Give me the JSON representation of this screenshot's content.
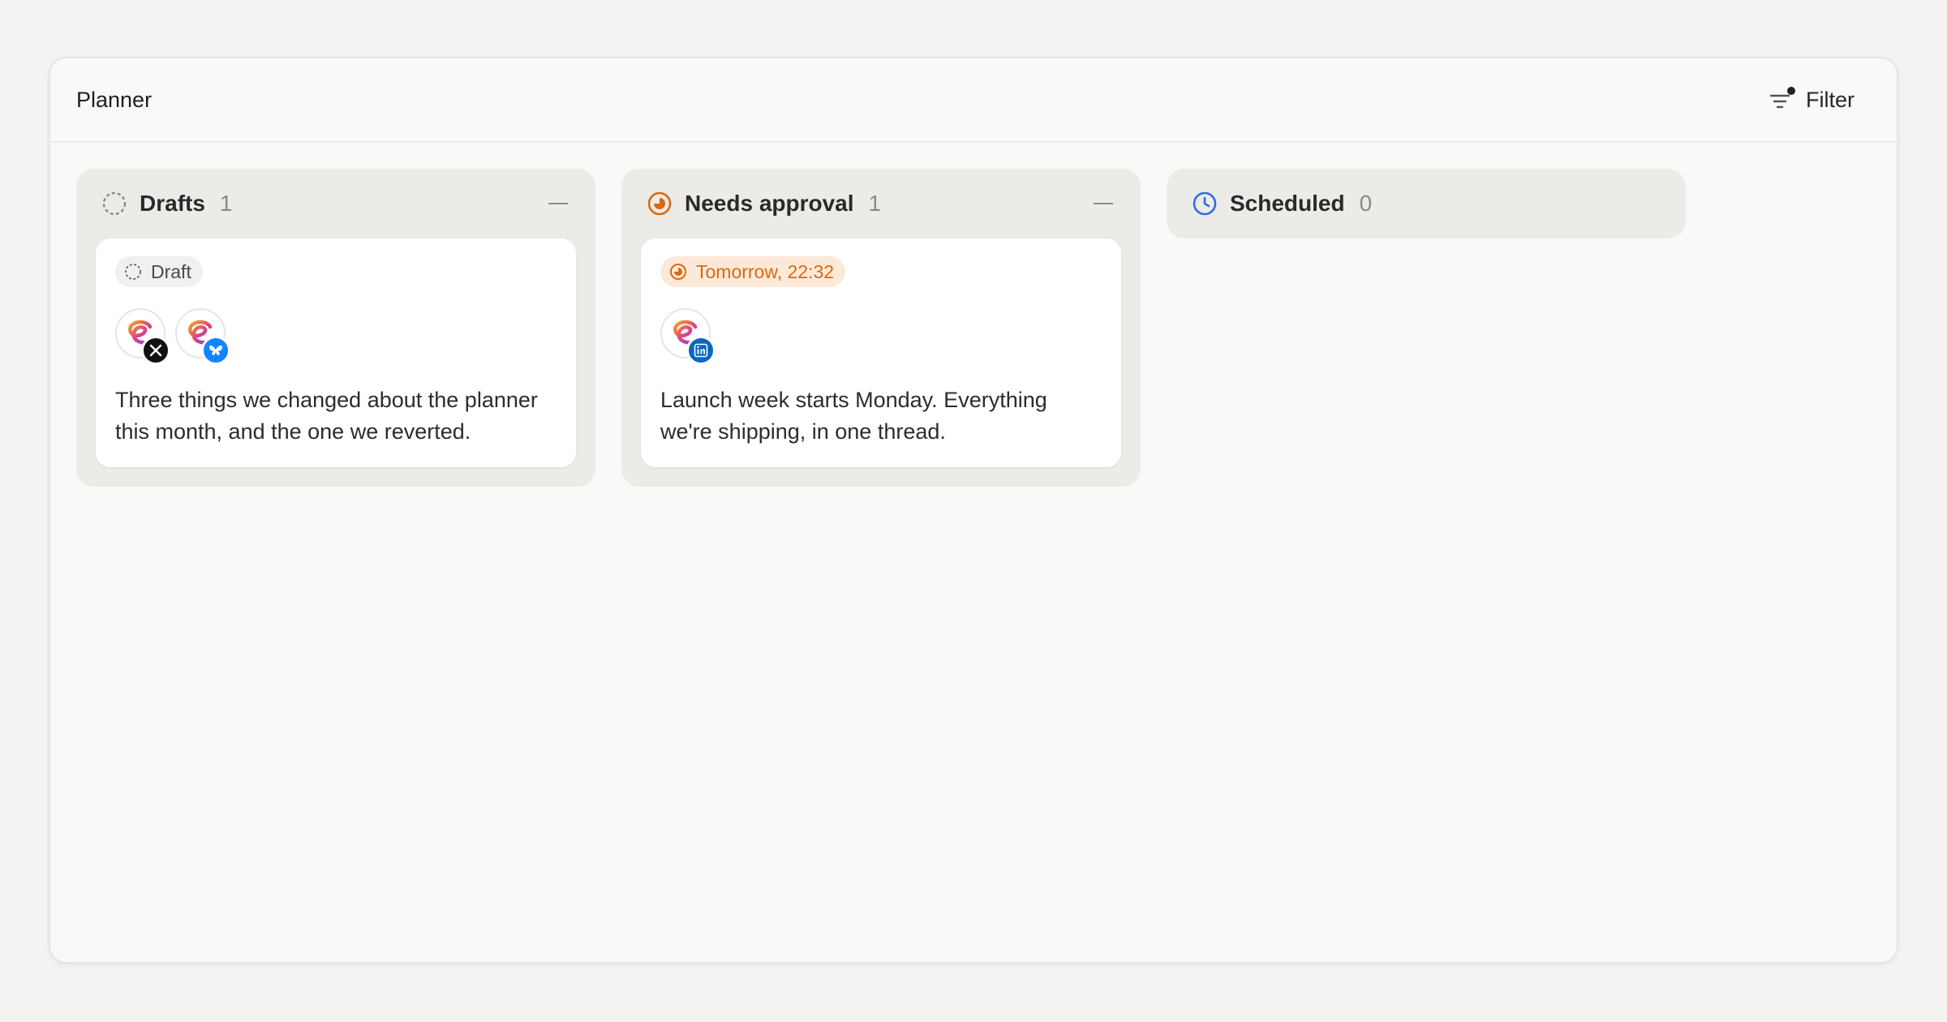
{
  "header": {
    "title": "Planner",
    "filter_label": "Filter"
  },
  "columns": [
    {
      "title": "Drafts",
      "count": "1",
      "card": {
        "pill": "Draft",
        "text": "Three things we changed about the planner this month, and the one we reverted.",
        "networks": [
          "x-icon",
          "bluesky-icon"
        ]
      }
    },
    {
      "title": "Needs approval",
      "count": "1",
      "card": {
        "pill": "Tomorrow, 22:32",
        "text": "Launch week starts Monday. Everything we're shipping, in one thread.",
        "networks": [
          "linkedin-icon"
        ]
      }
    },
    {
      "title": "Scheduled",
      "count": "0"
    }
  ],
  "colors": {
    "approval": "#d96a10",
    "scheduled": "#2f6fe0",
    "x": "#111111",
    "bluesky": "#1185fe",
    "linkedin": "#0a66c2"
  }
}
